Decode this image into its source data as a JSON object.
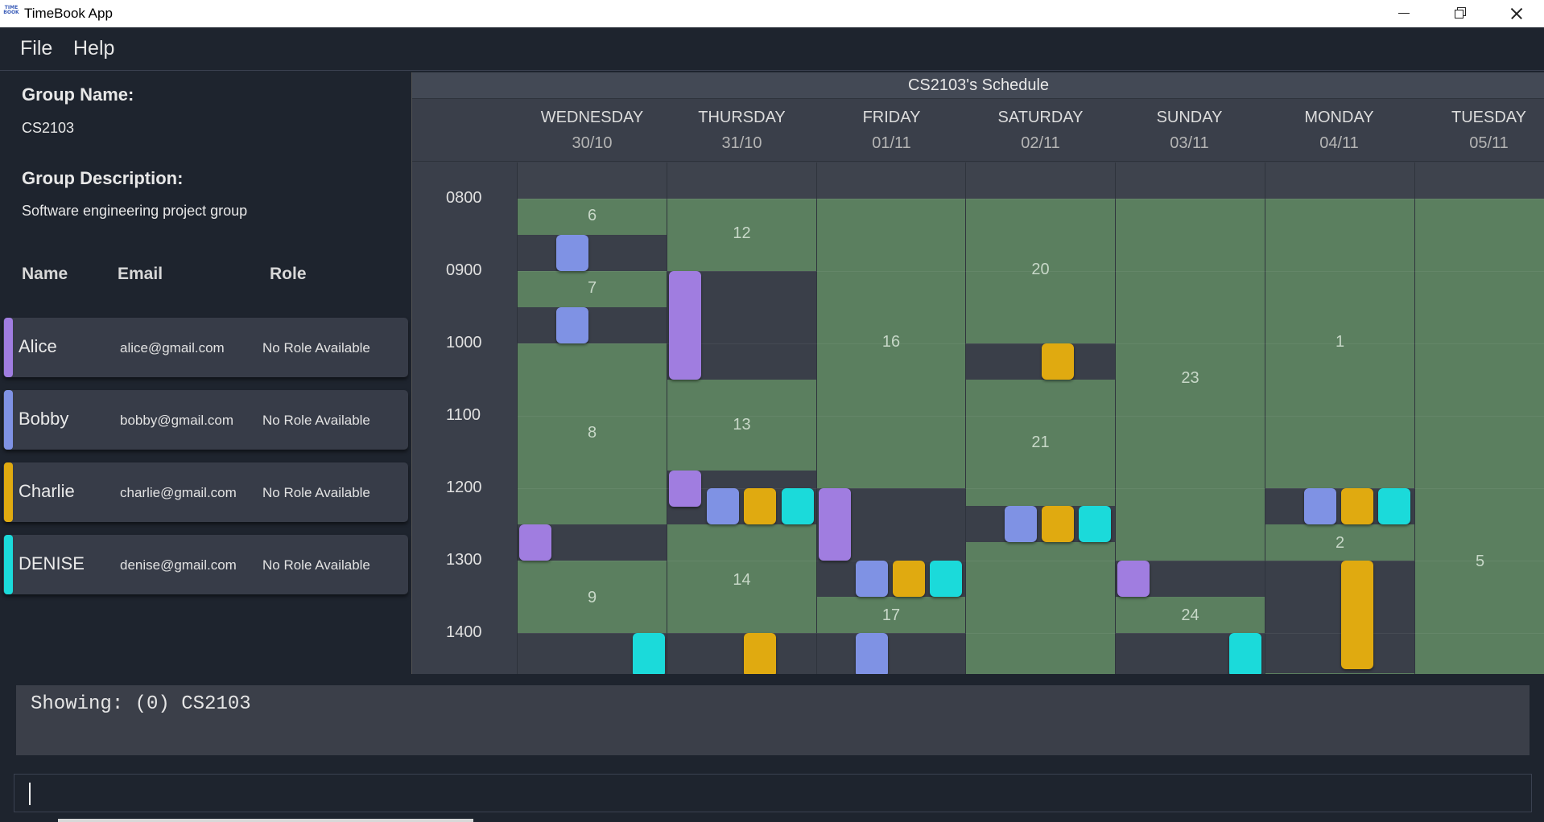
{
  "window": {
    "title": "TimeBook App",
    "icon_text": "TIME BOOK"
  },
  "menu": {
    "file": "File",
    "help": "Help"
  },
  "group": {
    "name_label": "Group Name:",
    "name": "CS2103",
    "desc_label": "Group Description:",
    "description": "Software engineering project group"
  },
  "members_header": {
    "name": "Name",
    "email": "Email",
    "role": "Role"
  },
  "members": [
    {
      "name": "Alice",
      "email": "alice@gmail.com",
      "role": "No Role Available",
      "color": "#a07de0"
    },
    {
      "name": "Bobby",
      "email": "bobby@gmail.com",
      "role": "No Role Available",
      "color": "#7f92e4"
    },
    {
      "name": "Charlie",
      "email": "charlie@gmail.com",
      "role": "No Role Available",
      "color": "#e0aa10"
    },
    {
      "name": "DENISE",
      "email": "denise@gmail.com",
      "role": "No Role Available",
      "color": "#1bdada"
    }
  ],
  "schedule": {
    "title": "CS2103's Schedule",
    "days": [
      {
        "name": "WEDNESDAY",
        "date": "30/10"
      },
      {
        "name": "THURSDAY",
        "date": "31/10"
      },
      {
        "name": "FRIDAY",
        "date": "01/11"
      },
      {
        "name": "SATURDAY",
        "date": "02/11"
      },
      {
        "name": "SUNDAY",
        "date": "03/11"
      },
      {
        "name": "MONDAY",
        "date": "04/11"
      },
      {
        "name": "TUESDAY",
        "date": "05/11"
      }
    ],
    "times": [
      "0800",
      "0900",
      "1000",
      "1100",
      "1200",
      "1300",
      "1400"
    ],
    "free_slot_numbers": [
      "6",
      "7",
      "8",
      "9",
      "12",
      "13",
      "14",
      "16",
      "17",
      "20",
      "21",
      "23",
      "24",
      "1",
      "2",
      "5"
    ]
  },
  "result": {
    "text": "Showing: (0) CS2103"
  },
  "command": {
    "value": ""
  },
  "colors": {
    "free": "#5b7f5f",
    "busy": "#3a3f49",
    "background": "#1e242e"
  }
}
